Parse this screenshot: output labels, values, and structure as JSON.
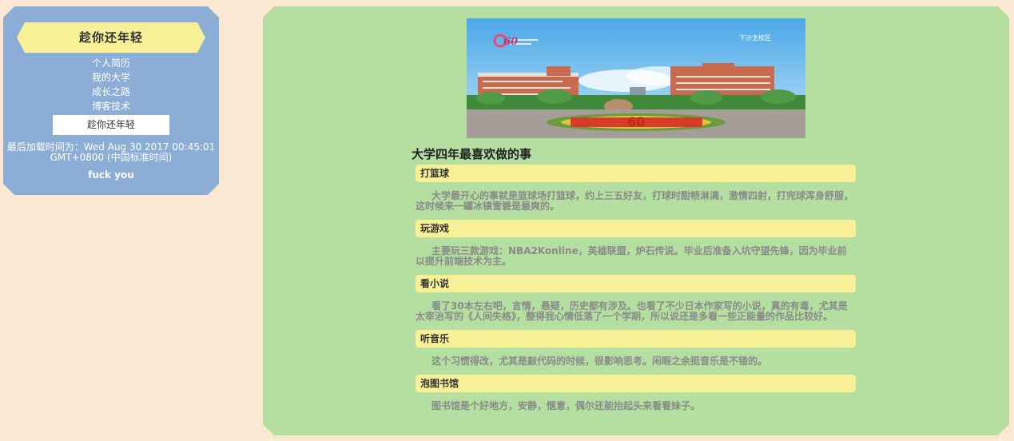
{
  "sidebar": {
    "title": "趁你还年轻",
    "nav": [
      {
        "label": "个人简历"
      },
      {
        "label": "我的大学"
      },
      {
        "label": "成长之路"
      },
      {
        "label": "博客技术"
      }
    ],
    "name_box": "趁你还年轻",
    "load_time_line1": "最后加载时间为：Wed Aug 30 2017 00:45:01",
    "load_time_line2": "GMT+0800 (中国标准时间)",
    "footer": "fuck you"
  },
  "banner": {
    "campus_label": "下沙主校区",
    "anniversary": "60",
    "logo_number": "60"
  },
  "main": {
    "heading": "大学四年最喜欢做的事",
    "topics": [
      {
        "title": "打篮球",
        "body": "大学最开心的事就是篮球场打篮球，约上三五好友，打球时酣畅淋漓，激情四射，打完球浑身舒服，这时候来一罐冰镇雪碧是最爽的。"
      },
      {
        "title": "玩游戏",
        "body": "主要玩三款游戏：NBA2Konline，英雄联盟，炉石传说。毕业后准备入坑守望先锋，因为毕业前以提升前端技术为主。"
      },
      {
        "title": "看小说",
        "body": "看了30本左右吧，言情，悬疑，历史都有涉及。也看了不少日本作家写的小说，真的有毒，尤其是太宰治写的《人间失格》，整得我心情低落了一个学期，所以说还是多看一些正能量的作品比较好。"
      },
      {
        "title": "听音乐",
        "body": "这个习惯得改，尤其是敲代码的时候，很影响思考。闲暇之余挺音乐是不错的。"
      },
      {
        "title": "泡图书馆",
        "body": "图书馆是个好地方，安静，惬意，偶尔还能抬起头来看看妹子。"
      }
    ]
  },
  "colors": {
    "page_bg": "#fbe8d3",
    "sidebar_bg": "#8badd6",
    "main_bg": "#b4dfa0",
    "accent_yellow": "#f7f096"
  }
}
